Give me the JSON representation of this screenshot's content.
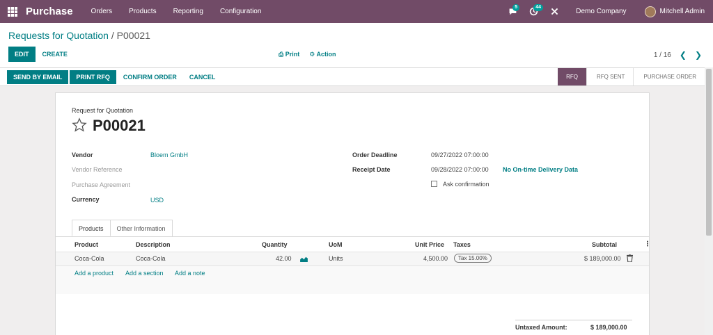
{
  "navbar": {
    "app_name": "Purchase",
    "menu": [
      "Orders",
      "Products",
      "Reporting",
      "Configuration"
    ],
    "chat_badge": "5",
    "activity_badge": "44",
    "company": "Demo Company",
    "user": "Mitchell Admin"
  },
  "breadcrumb": {
    "parent": "Requests for Quotation",
    "separator": "/",
    "current": "P00021"
  },
  "toolbar": {
    "edit_label": "EDIT",
    "create_label": "CREATE",
    "print_label": "Print",
    "action_label": "Action",
    "pager": "1 / 16"
  },
  "status_actions": {
    "send_by_email": "SEND BY EMAIL",
    "print_rfq": "PRINT RFQ",
    "confirm_order": "CONFIRM ORDER",
    "cancel": "CANCEL"
  },
  "stages": [
    {
      "label": "RFQ",
      "active": true
    },
    {
      "label": "RFQ SENT",
      "active": false
    },
    {
      "label": "PURCHASE ORDER",
      "active": false
    }
  ],
  "form": {
    "doc_label": "Request for Quotation",
    "doc_number": "P00021",
    "fields_left": {
      "vendor_label": "Vendor",
      "vendor_value": "Bloem GmbH",
      "vendor_ref_label": "Vendor Reference",
      "agreement_label": "Purchase Agreement",
      "currency_label": "Currency",
      "currency_value": "USD"
    },
    "fields_right": {
      "deadline_label": "Order Deadline",
      "deadline_value": "09/27/2022 07:00:00",
      "receipt_label": "Receipt Date",
      "receipt_value": "09/28/2022 07:00:00",
      "ontime_label": "No On-time Delivery Data",
      "ask_confirmation_label": "Ask confirmation",
      "ask_confirmation_checked": false
    }
  },
  "tabs": [
    "Products",
    "Other Information"
  ],
  "table": {
    "headers": {
      "product": "Product",
      "description": "Description",
      "quantity": "Quantity",
      "uom": "UoM",
      "unit_price": "Unit Price",
      "taxes": "Taxes",
      "subtotal": "Subtotal"
    },
    "rows": [
      {
        "product": "Coca-Cola",
        "description": "Coca-Cola",
        "quantity": "42.00",
        "uom": "Units",
        "unit_price": "4,500.00",
        "taxes": "Tax 15.00%",
        "subtotal": "$ 189,000.00"
      }
    ],
    "add_product": "Add a product",
    "add_section": "Add a section",
    "add_note": "Add a note"
  },
  "totals": {
    "untaxed_label": "Untaxed Amount:",
    "untaxed_value": "$ 189,000.00"
  },
  "icons": {
    "apps": "apps-grid-icon",
    "chat": "chat-icon",
    "activity": "activity-clock-icon",
    "debug": "tools-icon",
    "star": "star-outline-icon",
    "print": "print-icon",
    "action": "gear-icon",
    "forecast": "area-chart-icon",
    "delete": "trash-icon"
  },
  "colors": {
    "brand": "#714b67",
    "primary": "#017e84",
    "badge": "#00a09d"
  }
}
